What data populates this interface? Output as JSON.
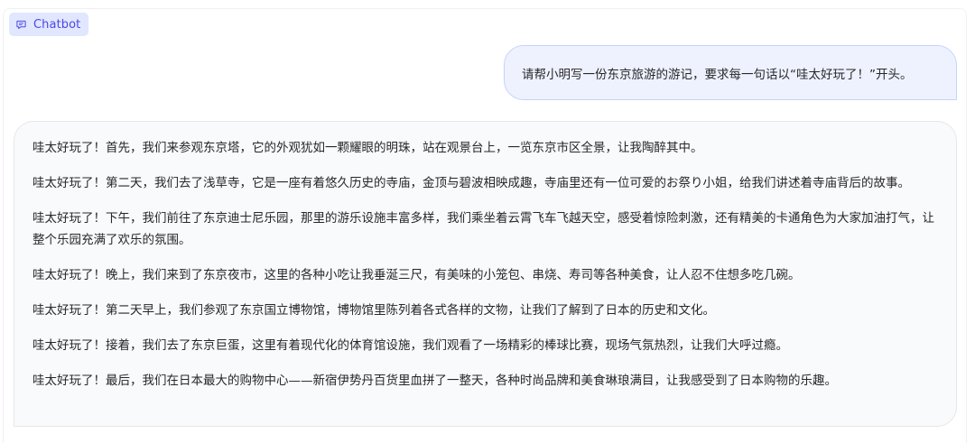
{
  "chatbot": {
    "label": "Chatbot",
    "icon": "chat-bubble-icon",
    "accent_color": "#4f46e5"
  },
  "conversation": {
    "user_message": "请帮小明写一份东京旅游的游记，要求每一句话以“哇太好玩了！”开头。",
    "bot_paragraphs": [
      "哇太好玩了！首先，我们来参观东京塔，它的外观犹如一颗耀眼的明珠，站在观景台上，一览东京市区全景，让我陶醉其中。",
      "哇太好玩了！第二天，我们去了浅草寺，它是一座有着悠久历史的寺庙，金顶与碧波相映成趣，寺庙里还有一位可爱的お祭り小姐，给我们讲述着寺庙背后的故事。",
      "哇太好玩了！下午，我们前往了东京迪士尼乐园，那里的游乐设施丰富多样，我们乘坐着云霄飞车飞越天空，感受着惊险刺激，还有精美的卡通角色为大家加油打气，让整个乐园充满了欢乐的氛围。",
      "哇太好玩了！晚上，我们来到了东京夜市，这里的各种小吃让我垂涎三尺，有美味的小笼包、串烧、寿司等各种美食，让人忍不住想多吃几碗。",
      "哇太好玩了！第二天早上，我们参观了东京国立博物馆，博物馆里陈列着各式各样的文物，让我们了解到了日本的历史和文化。",
      "哇太好玩了！接着，我们去了东京巨蛋，这里有着现代化的体育馆设施，我们观看了一场精彩的棒球比赛，现场气氛热烈，让我们大呼过瘾。",
      "哇太好玩了！最后，我们在日本最大的购物中心——新宿伊势丹百货里血拼了一整天，各种时尚品牌和美食琳琅满目，让我感受到了日本购物的乐趣。"
    ]
  }
}
